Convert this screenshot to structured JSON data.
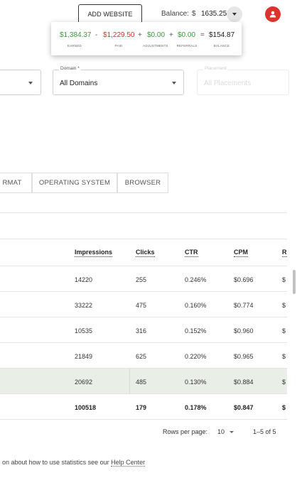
{
  "header": {
    "add_website_label": "ADD WEBSITE",
    "balance_label": "Balance:",
    "balance_currency": "$",
    "balance_value": "1635.25"
  },
  "balance_popover": {
    "earned": {
      "value": "$1,384.37",
      "label": "EARNED"
    },
    "paid": {
      "value": "$1,229.50",
      "label": "PAID"
    },
    "adjustments": {
      "value": "$0.00",
      "label": "ADJUSTMENTS"
    },
    "referrals": {
      "value": "$0.00",
      "label": "REFERRALS"
    },
    "balance": {
      "value": "$154.87",
      "label": "BALANCE"
    },
    "ops": {
      "minus": "-",
      "plus1": "+",
      "plus2": "+",
      "equals": "="
    }
  },
  "filters": {
    "domain": {
      "label": "Domain *",
      "value": "All Domains"
    },
    "placement": {
      "label": "Placement",
      "placeholder": "All Placements"
    }
  },
  "tabs": [
    {
      "label": "RMAT"
    },
    {
      "label": "OPERATING SYSTEM"
    },
    {
      "label": "BROWSER"
    }
  ],
  "table": {
    "columns": [
      "Impressions",
      "Clicks",
      "CTR",
      "CPM",
      "R"
    ],
    "rows": [
      {
        "impressions": "14220",
        "clicks": "255",
        "ctr": "0.246%",
        "cpm": "$0.696",
        "r": "$"
      },
      {
        "impressions": "33222",
        "clicks": "475",
        "ctr": "0.160%",
        "cpm": "$0.774",
        "r": "$"
      },
      {
        "impressions": "10535",
        "clicks": "316",
        "ctr": "0.152%",
        "cpm": "$0.960",
        "r": "$"
      },
      {
        "impressions": "21849",
        "clicks": "625",
        "ctr": "0.220%",
        "cpm": "$0.965",
        "r": "$"
      },
      {
        "impressions": "20692",
        "clicks": "485",
        "ctr": "0.130%",
        "cpm": "$0.884",
        "r": "$"
      }
    ],
    "total": {
      "impressions": "100518",
      "clicks": "179",
      "ctr": "0.178%",
      "cpm": "$0.847",
      "r": "$"
    }
  },
  "pagination": {
    "rows_per_page_label": "Rows per page:",
    "rows_per_page_value": "10",
    "range": "1–5 of 5"
  },
  "footer": {
    "text": "on about how to use statistics see our ",
    "link": "Help Center"
  },
  "colors": {
    "earned": "#3c9a3c",
    "paid": "#d0352b",
    "avatar": "#e0322d",
    "highlight_row": "#e9eee6"
  }
}
